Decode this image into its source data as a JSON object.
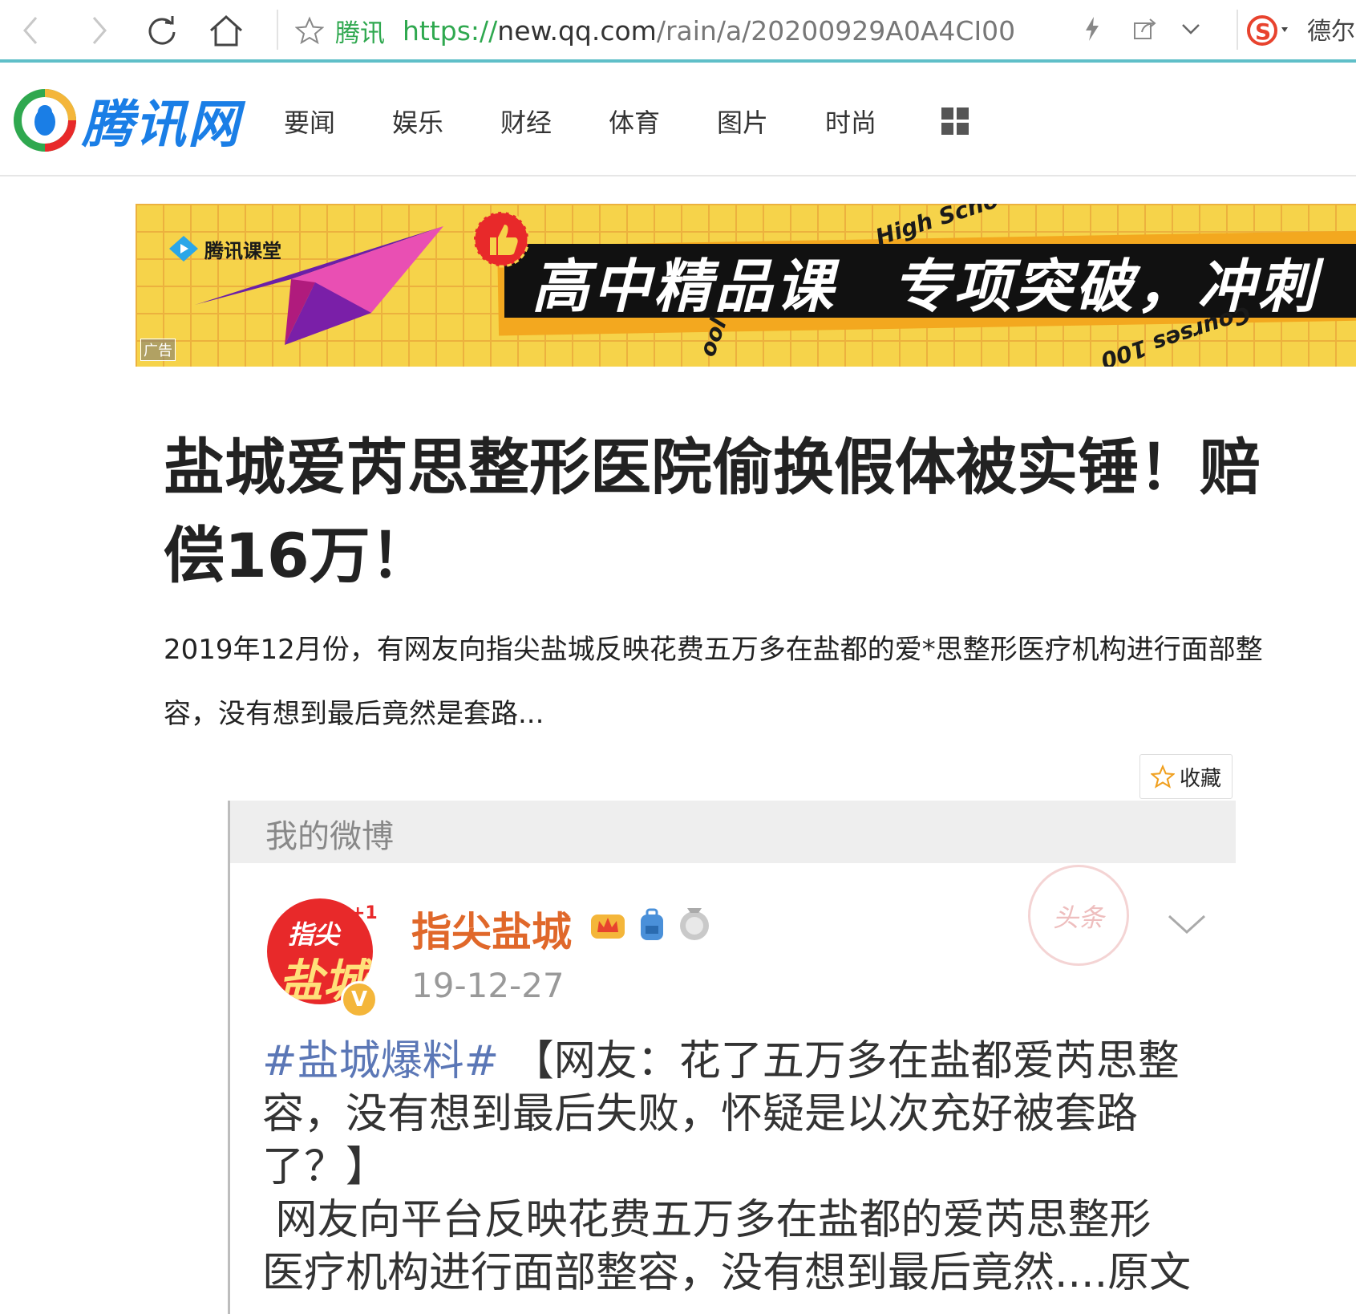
{
  "browser": {
    "site_label": "腾讯",
    "url_protocol": "https://",
    "url_host": "new.qq.com",
    "url_path": "/rain/a/20200929A0A4CI00",
    "user_name": "德尔"
  },
  "site": {
    "logo_text": "腾讯网",
    "nav": [
      "要闻",
      "娱乐",
      "财经",
      "体育",
      "图片",
      "时尚"
    ]
  },
  "banner": {
    "brand": "腾讯课堂",
    "title_part1": "高中精品课",
    "title_part2": "专项突破，冲刺",
    "ribbon_top": "High Scho",
    "ribbon_bottom": "Courses 100",
    "ribbon_left": "ool",
    "ad_label": "广告"
  },
  "article": {
    "headline": "盐城爱芮思整形医院偷换假体被实锤！赔偿16万！",
    "summary": "2019年12月份，有网友向指尖盐城反映花费五万多在盐都的爱*思整形医疗机构进行面部整容，没有想到最后竟然是套路...",
    "favorite_label": "收藏"
  },
  "weibo": {
    "header": "我的微博",
    "avatar_text_top": "指尖",
    "avatar_text_bottom": "盐城",
    "plus_one": "+1",
    "verified": "V",
    "account": "指尖盐城",
    "date": "19-12-27",
    "stamp_text": "头条",
    "hashtag": "#盐城爆料#",
    "post_quote": "【网友：花了五万多在盐都爱芮思整容，没有想到最后失败，怀疑是以次充好被套路了？】",
    "post_body": "网友向平台反映花费五万多在盐都的爱芮思整形医疗机构进行面部整容，没有想到最后竟然....原文"
  },
  "colors": {
    "accent_teal": "#5fbfc8",
    "url_green": "#2fa84f",
    "logo_blue": "#1a7ee6",
    "banner_yellow": "#f6d34a",
    "weibo_name_orange": "#e0682a",
    "hashtag_blue": "#5b77b6"
  },
  "icons": [
    "back-icon",
    "forward-icon",
    "reload-icon",
    "home-icon",
    "star-icon",
    "lightning-icon",
    "share-icon",
    "chevron-down-icon",
    "sogou-icon",
    "grid-menu-icon",
    "favorite-star-icon",
    "chevron-down-icon"
  ]
}
